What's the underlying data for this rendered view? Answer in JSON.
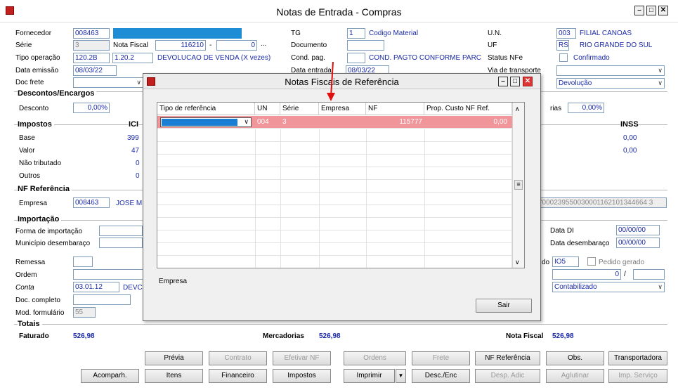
{
  "window": {
    "title": "Notas de Entrada - Compras"
  },
  "form": {
    "fornecedor_label": "Fornecedor",
    "fornecedor_value": "008463",
    "serie_label": "Série",
    "serie_value": "3",
    "nota_fiscal_label": "Nota Fiscal",
    "nota_fiscal_value": "116210",
    "nota_dash": "-",
    "nota_suffix": "0",
    "ellipsis": "...",
    "tipo_op_label": "Tipo operação",
    "tipo_op_code": "120.2B",
    "tipo_op_code2": "1.20.2",
    "tipo_op_desc": "DEVOLUCAO DE VENDA (X vezes)",
    "data_emissao_label": "Data emissão",
    "data_emissao_value": "08/03/22",
    "doc_frete_label": "Doc frete",
    "tg_label": "TG",
    "tg_value": "1",
    "tg_desc": "Codigo Material",
    "documento_label": "Documento",
    "cond_pag_label": "Cond. pag.",
    "cond_pag_desc": "COND. PAGTO CONFORME PARC",
    "data_entrada_label": "Data entrada",
    "data_entrada_value": "08/03/22",
    "un_label": "U.N.",
    "un_code": "003",
    "un_desc": "FILIAL CANOAS",
    "uf_label": "UF",
    "uf_code": "RS",
    "uf_desc": "RIO GRANDE DO SUL",
    "status_nfe_label": "Status NFe",
    "status_nfe_value": "Confirmado",
    "via_transp_label": "Via de transporte",
    "devolucao_value": "Devolução",
    "descontos_header": "Descontos/Encargos",
    "desconto_label": "Desconto",
    "desconto_value": "0,00%",
    "rias_label": "rias",
    "rias_value": "0,00%",
    "impostos_header": "Impostos",
    "icms_header": "ICI",
    "inss_header": "INSS",
    "base_label": "Base",
    "base_value": "399",
    "valor_label": "Valor",
    "valor_value": "47",
    "nao_trib_label": "Não tributado",
    "nao_trib_value": "0",
    "outros_label": "Outros",
    "outros_value": "0",
    "inss_base": "0,00",
    "inss_valor": "0,00",
    "nf_ref_header": "NF Referência",
    "empresa_label": "Empresa",
    "empresa_value": "008463",
    "empresa_name": "JOSE M",
    "chave_value": "7000239550030001162101344664 3",
    "importacao_header": "Importação",
    "forma_imp_label": "Forma de importação",
    "municipio_label": "Município desembaraço",
    "data_di_label": "Data DI",
    "data_di_value": "00/00/00",
    "data_desemb_label": "Data desembaraço",
    "data_desemb_value": "00/00/00",
    "remessa_label": "Remessa",
    "ordem_label": "Ordem",
    "conta_label": "Conta",
    "conta_value": "03.01.12",
    "conta_desc": "DEVC",
    "doc_completo_label": "Doc. completo",
    "mod_form_label": "Mod. formulário",
    "mod_form_value": "55",
    "do_label": "do",
    "do_value": "IO5",
    "pedido_gerado_label": "Pedido gerado",
    "seq_value": "0",
    "slash": "/",
    "contabilizado_value": "Contabilizado",
    "totais_header": "Totais",
    "faturado_label": "Faturado",
    "faturado_value": "526,98",
    "mercadorias_label": "Mercadorias",
    "mercadorias_value": "526,98",
    "nota_fiscal_total_label": "Nota Fiscal",
    "nota_fiscal_total_value": "526,98"
  },
  "buttons": {
    "row1": [
      "Prévia",
      "Contrato",
      "Efetivar NF",
      "Ordens",
      "Frete",
      "NF Referência",
      "Obs.",
      "Transportadora"
    ],
    "row2": [
      "Acomparh.",
      "Itens",
      "Financeiro",
      "Impostos",
      "Imprimir",
      "Desc./Enc",
      "Desp. Adic",
      "Aglutinar",
      "Imp. Serviço"
    ]
  },
  "dialog": {
    "title": "Notas Fiscais de Referência",
    "columns": [
      "Tipo de referência",
      "UN",
      "Série",
      "Empresa",
      "NF",
      "Prop. Custo NF Ref."
    ],
    "row": {
      "un": "004",
      "serie": "3",
      "empresa": "",
      "nf": "115777",
      "prop": "0,00"
    },
    "empresa_label": "Empresa",
    "sair_label": "Sair"
  },
  "colors": {
    "selected_row": "#f0959a",
    "dropdown_fill": "#1a7fd4",
    "fornecedor_name_fill": "#1f8dd6",
    "label_blue": "#1a2aa8"
  }
}
